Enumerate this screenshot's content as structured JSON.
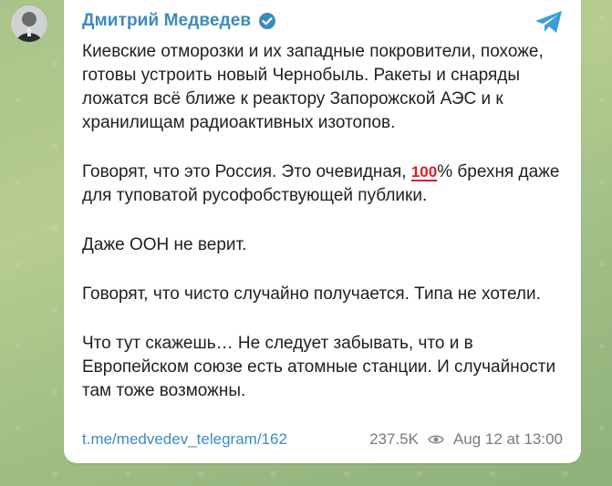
{
  "post": {
    "channel_name": "Дмитрий Медведев",
    "paragraphs": {
      "p1": "Киевские отморозки и их западные покровители, похоже, готовы устроить новый Чернобыль. Ракеты и снаряды ложатся всё ближе к реактору Запорожской АЭС и к хранилищам радиоактивных изотопов.",
      "p2_before_emoji": "Говорят, что это Россия. Это очевидная, ",
      "p2_emoji": "100",
      "p2_after_emoji": "% брехня даже для туповатой русофобствующей публики.",
      "p3": "Даже ООН не верит.",
      "p4": "Говорят, что чисто случайно получается. Типа не хотели.",
      "p5": "Что тут скажешь… Не следует забывать, что и в Европейском союзе есть атомные станции. И случайности там тоже возможны."
    },
    "link_text": "t.me/medvedev_telegram/162",
    "views": "237.5K",
    "timestamp": "Aug 12 at 13:00"
  },
  "icons": {
    "verified": "verified-badge-icon",
    "share": "telegram-share-icon",
    "views": "eye-icon"
  },
  "colors": {
    "accent": "#3a8bbf",
    "meta_text": "#7a7a7a",
    "background": "#a9c38a"
  }
}
